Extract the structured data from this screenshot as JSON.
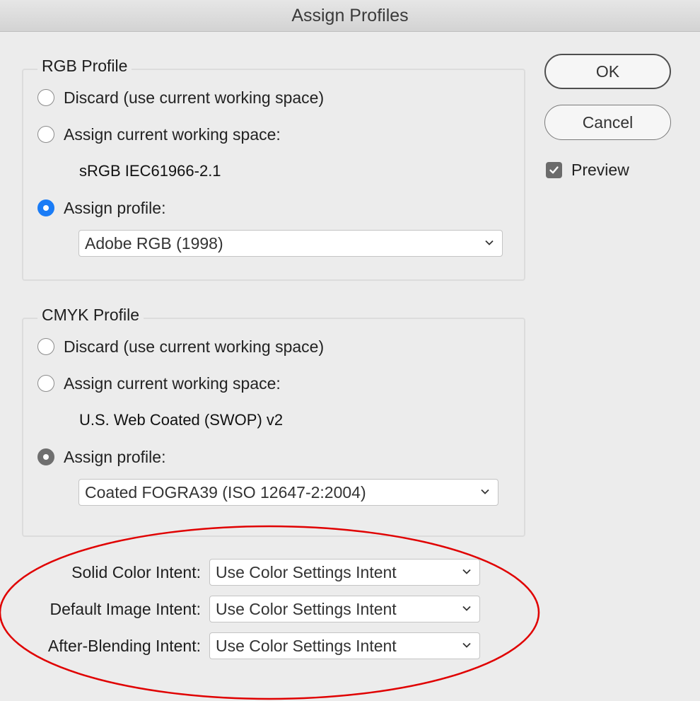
{
  "window": {
    "title": "Assign Profiles"
  },
  "rgb": {
    "legend": "RGB Profile",
    "discard_label": "Discard (use current working space)",
    "assign_current_label": "Assign current working space:",
    "working_space": "sRGB IEC61966-2.1",
    "assign_profile_label": "Assign profile:",
    "selected_option": "assign-profile",
    "profile_value": "Adobe RGB (1998)"
  },
  "cmyk": {
    "legend": "CMYK Profile",
    "discard_label": "Discard (use current working space)",
    "assign_current_label": "Assign current working space:",
    "working_space": "U.S. Web Coated (SWOP) v2",
    "assign_profile_label": "Assign profile:",
    "selected_option": "assign-profile",
    "profile_value": "Coated FOGRA39 (ISO 12647-2:2004)"
  },
  "intents": [
    {
      "label": "Solid Color Intent:",
      "value": "Use Color Settings Intent"
    },
    {
      "label": "Default Image Intent:",
      "value": "Use Color Settings Intent"
    },
    {
      "label": "After-Blending Intent:",
      "value": "Use Color Settings Intent"
    }
  ],
  "buttons": {
    "ok": "OK",
    "cancel": "Cancel"
  },
  "preview": {
    "label": "Preview",
    "checked": true
  },
  "colors": {
    "accent": "#1a7cf6",
    "annotation": "#e00000",
    "dialog_bg": "#ececec"
  },
  "icons": {
    "dropdown": "chevron-down-icon",
    "check": "checkmark-icon"
  }
}
